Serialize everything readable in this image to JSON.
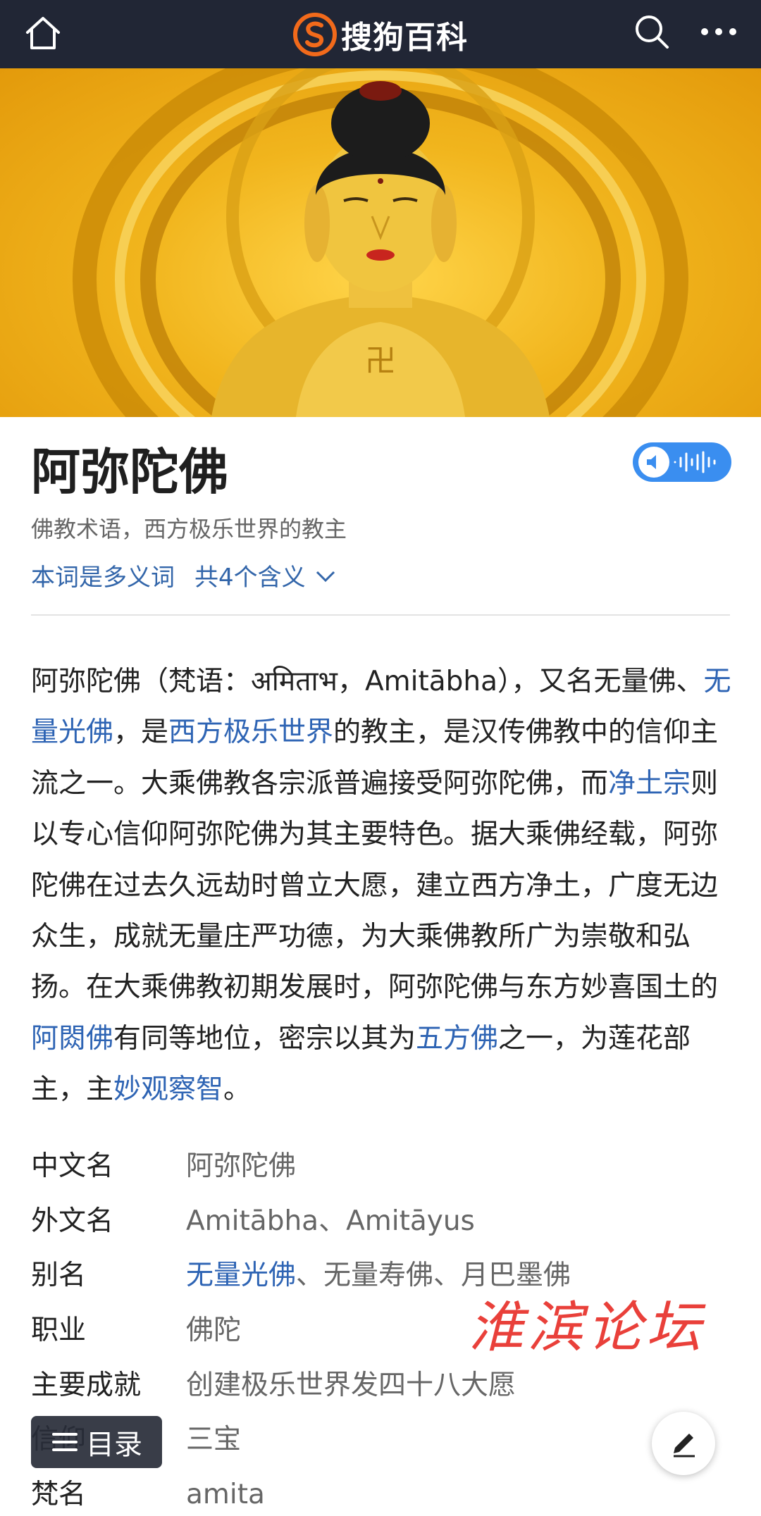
{
  "topbar": {
    "brand": "搜狗百科",
    "icons": [
      "home-icon",
      "sogou-logo-icon",
      "search-icon",
      "more-icon"
    ],
    "bg_color": "#212635"
  },
  "article": {
    "title": "阿弥陀佛",
    "subtitle": "佛教术语，西方极乐世界的教主",
    "polysemy_label": "本词是多义词",
    "meanings_label": "共4个含义",
    "paragraph": [
      {
        "text": "阿弥陀佛（梵语：अमिताभ，Amitābha），又名无量佛、",
        "link": false
      },
      {
        "text": "无量光佛",
        "link": true
      },
      {
        "text": "，是",
        "link": false
      },
      {
        "text": "西方极乐世界",
        "link": true
      },
      {
        "text": "的教主，是汉传佛教中的信仰主流之一。大乘佛教各宗派普遍接受阿弥陀佛，而",
        "link": false
      },
      {
        "text": "净土宗",
        "link": true
      },
      {
        "text": "则以专心信仰阿弥陀佛为其主要特色。据大乘佛经载，阿弥陀佛在过去久远劫时曾立大愿，建立西方净土，广度无边众生，成就无量庄严功德，为大乘佛教所广为崇敬和弘扬。在大乘佛教初期发展时，阿弥陀佛与东方妙喜国土的",
        "link": false
      },
      {
        "text": "阿閦佛",
        "link": true
      },
      {
        "text": "有同等地位，密宗以其为",
        "link": false
      },
      {
        "text": "五方佛",
        "link": true
      },
      {
        "text": "之一，为莲花部主，主",
        "link": false
      },
      {
        "text": "妙观察智",
        "link": true
      },
      {
        "text": "。",
        "link": false
      }
    ]
  },
  "infobox": {
    "rows": [
      {
        "key": "中文名",
        "value": "阿弥陀佛"
      },
      {
        "key": "外文名",
        "value": "Amitābha、Amitāyus"
      },
      {
        "key": "别名",
        "value_link": "无量光佛",
        "value": "、无量寿佛、月巴墨佛"
      },
      {
        "key": "职业",
        "value": "佛陀"
      },
      {
        "key": "主要成就",
        "value": "创建极乐世界发四十八大愿"
      },
      {
        "key": "信仰",
        "value": "三宝"
      },
      {
        "key": "梵名",
        "value": "amita"
      }
    ]
  },
  "watermark": "淮滨论坛",
  "floating": {
    "toc_label": "目录",
    "edit_icon": "pencil-icon"
  },
  "colors": {
    "link": "#2e64b4",
    "audio_button": "#3a8ef0",
    "watermark": "#e8302a"
  }
}
